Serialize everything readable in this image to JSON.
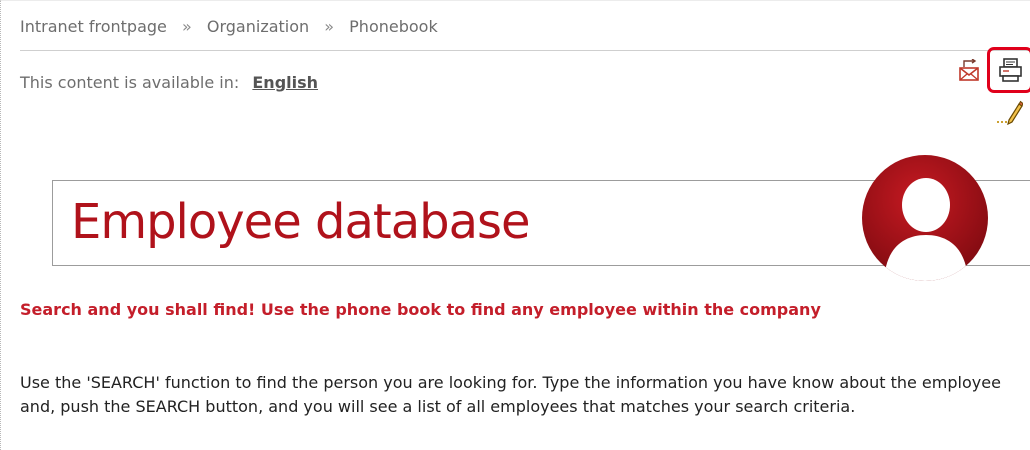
{
  "breadcrumb": {
    "items": [
      "Intranet frontpage",
      "Organization",
      "Phonebook"
    ],
    "separator": "»"
  },
  "language": {
    "label": "This content is available in:",
    "link": "English"
  },
  "tools": {
    "icons": [
      "email-icon",
      "print-icon",
      "edit-icon"
    ],
    "highlight_color": "#e0001b"
  },
  "banner": {
    "title": "Employee database",
    "title_color": "#b0121b",
    "avatar_icon": "person-icon"
  },
  "content": {
    "lead": "Search and you shall find! Use the phone book to find any employee within the company",
    "body": "Use the 'SEARCH' function to find the person you are looking for. Type the information you have know about the employee and, push the SEARCH button, and you will see a list of all employees that matches your search criteria."
  },
  "colors": {
    "accent_red": "#c41e2a",
    "text_gray": "#6e6e6e"
  }
}
